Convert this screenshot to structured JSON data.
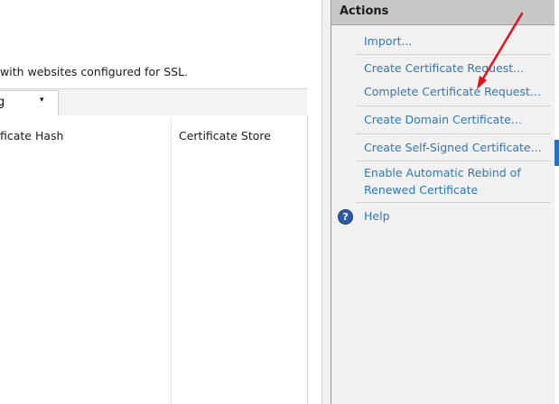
{
  "main": {
    "description": "with websites configured for SSL.",
    "group_by": {
      "value": "g",
      "arrow": "▾"
    },
    "columns": [
      "ficate Hash",
      "Certificate Store"
    ]
  },
  "actions": {
    "title": "Actions",
    "items": [
      {
        "label": "Import..."
      },
      {
        "label": "Create Certificate Request..."
      },
      {
        "label": "Complete Certificate Request..."
      },
      {
        "label": "Create Domain Certificate..."
      },
      {
        "label": "Create Self-Signed Certificate..."
      },
      {
        "label": "Enable Automatic Rebind of"
      },
      {
        "label": "Renewed Certificate"
      },
      {
        "label": "Help"
      }
    ],
    "help_icon": "?"
  },
  "colors": {
    "link": "#2f78b7",
    "header_bg": "#c8c8c8",
    "panel_bg": "#f1f1f1",
    "annotation_arrow": "#e0141e"
  },
  "icons": [
    "dropdown-arrow-icon",
    "help-icon",
    "annotation-arrow-icon"
  ]
}
